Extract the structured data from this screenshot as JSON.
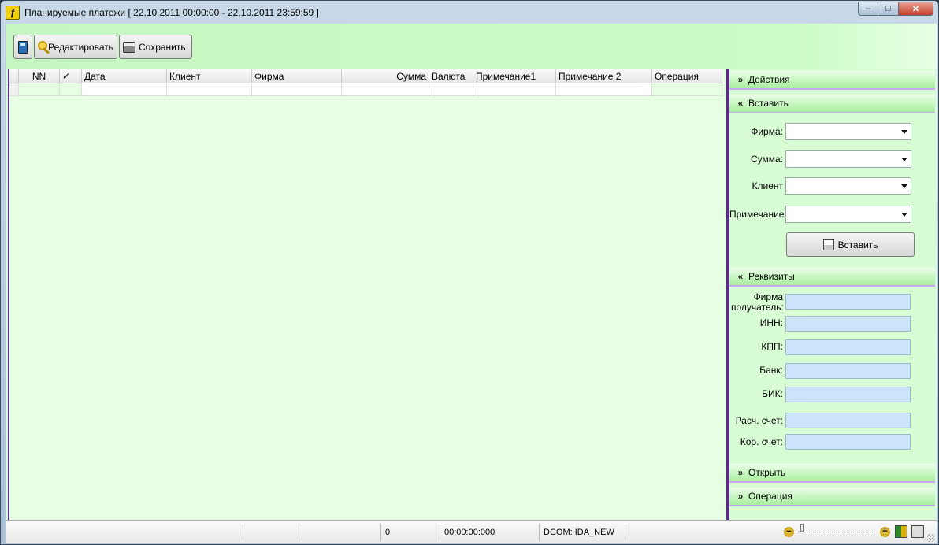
{
  "window": {
    "title": "Планируемые платежи [ 22.10.2011 00:00:00  -  22.10.2011 23:59:59 ]",
    "app_icon_glyph": "ƒ",
    "controls": {
      "minimize": "–",
      "maximize": "□",
      "close": "✕"
    }
  },
  "toolbar": {
    "calc_icon": "calculator-icon",
    "edit_label": "Редактировать",
    "save_label": "Сохранить"
  },
  "grid": {
    "columns": [
      "NN",
      "✓",
      "Дата",
      "Клиент",
      "Фирма",
      "Сумма",
      "Валюта",
      "Примечание1",
      "Примечание 2",
      "Операция"
    ]
  },
  "panel": {
    "actions": {
      "chev": "»",
      "label": "Действия"
    },
    "insert": {
      "chev": "«",
      "label": "Вставить",
      "firm_label": "Фирма:",
      "sum_label": "Сумма:",
      "client_label": "Клиент",
      "note_label": "Примечание:",
      "button_label": "Вставить"
    },
    "requisites": {
      "chev": "«",
      "label": "Реквизиты",
      "firm_recipient_label_1": "Фирма",
      "firm_recipient_label_2": "получатель:",
      "inn_label": "ИНН:",
      "kpp_label": "КПП:",
      "bank_label": "Банк:",
      "bik_label": "БИК:",
      "account_label": "Расч. счет:",
      "corr_account_label": "Кор. счет:"
    },
    "open": {
      "chev": "»",
      "label": "Открыть"
    },
    "operation": {
      "chev": "»",
      "label": "Операция"
    }
  },
  "status": {
    "count": "0",
    "time": "00:00:00:000",
    "connection": "DCOM: IDA_NEW",
    "zoom_minus": "−",
    "zoom_plus": "+"
  },
  "colors": {
    "client_bg": "#d8fdd5",
    "accent_purple": "#5a2a8a",
    "input_blue": "#cce4fb"
  }
}
